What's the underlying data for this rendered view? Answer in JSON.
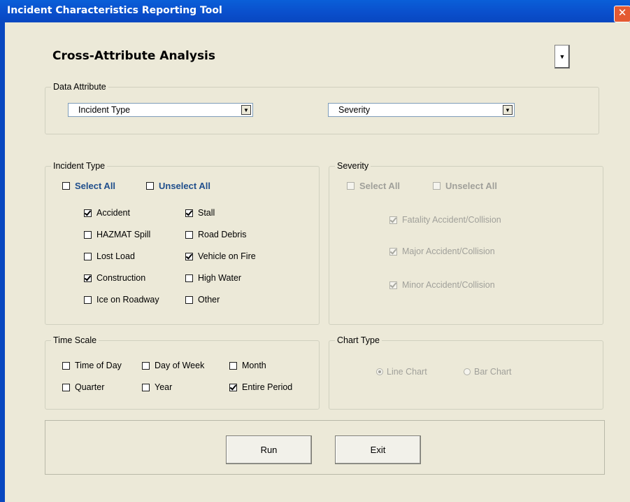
{
  "window": {
    "title": "Incident Characteristics Reporting Tool"
  },
  "page": {
    "heading": "Cross-Attribute Analysis"
  },
  "data_attribute": {
    "legend": "Data Attribute",
    "combo1": "Incident Type",
    "combo2": "Severity"
  },
  "incident_type": {
    "legend": "Incident Type",
    "select_all": "Select All",
    "unselect_all": "Unselect All",
    "items": [
      {
        "label": "Accident",
        "checked": true
      },
      {
        "label": "Stall",
        "checked": true
      },
      {
        "label": "HAZMAT Spill",
        "checked": false
      },
      {
        "label": "Road Debris",
        "checked": false
      },
      {
        "label": "Lost Load",
        "checked": false
      },
      {
        "label": "Vehicle on Fire",
        "checked": true
      },
      {
        "label": "Construction",
        "checked": true
      },
      {
        "label": "High Water",
        "checked": false
      },
      {
        "label": "Ice on Roadway",
        "checked": false
      },
      {
        "label": "Other",
        "checked": false
      }
    ]
  },
  "severity": {
    "legend": "Severity",
    "select_all": "Select All",
    "unselect_all": "Unselect All",
    "items": [
      {
        "label": "Fatality Accident/Collision",
        "checked": true
      },
      {
        "label": "Major Accident/Collision",
        "checked": true
      },
      {
        "label": "Minor Accident/Collision",
        "checked": true
      }
    ]
  },
  "time_scale": {
    "legend": "Time Scale",
    "items": [
      {
        "label": "Time of Day",
        "checked": false
      },
      {
        "label": "Day of Week",
        "checked": false
      },
      {
        "label": "Month",
        "checked": false
      },
      {
        "label": "Quarter",
        "checked": false
      },
      {
        "label": "Year",
        "checked": false
      },
      {
        "label": "Entire Period",
        "checked": true
      }
    ]
  },
  "chart_type": {
    "legend": "Chart Type",
    "options": [
      {
        "label": "Line Chart",
        "selected": true
      },
      {
        "label": "Bar Chart",
        "selected": false
      }
    ]
  },
  "buttons": {
    "run": "Run",
    "exit": "Exit"
  }
}
